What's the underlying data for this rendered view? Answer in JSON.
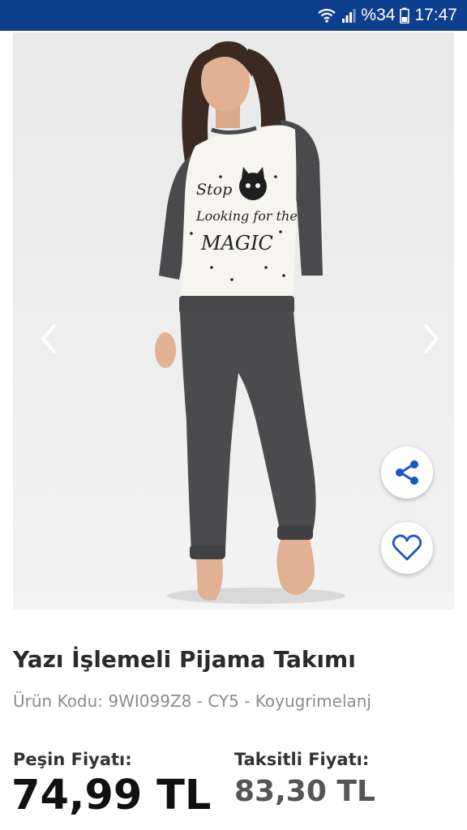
{
  "status_bar": {
    "battery_percent": "%34",
    "time": "17:47",
    "icons": [
      "wifi-icon",
      "signal-icon",
      "battery-icon"
    ]
  },
  "gallery": {
    "shirt_print": [
      "Stop",
      "Looking for the",
      "MAGIC"
    ],
    "prev_icon": "chevron-left-icon",
    "next_icon": "chevron-right-icon",
    "share_icon": "share-icon",
    "favorite_icon": "heart-icon"
  },
  "product": {
    "title": "Yazı İşlemeli Pijama Takımı",
    "code": "Ürün Kodu: 9WI099Z8 - CY5 - Koyugrimelanj",
    "cash_label": "Peşin Fiyatı:",
    "cash_price": "74,99 TL",
    "installment_label": "Taksitli Fiyatı:",
    "installment_price": "83,30 TL"
  },
  "colors": {
    "status_bar": "#0d3f8e",
    "accent": "#1a56c4",
    "text_primary": "#2b2b2b",
    "text_secondary": "#8c8c8c"
  }
}
